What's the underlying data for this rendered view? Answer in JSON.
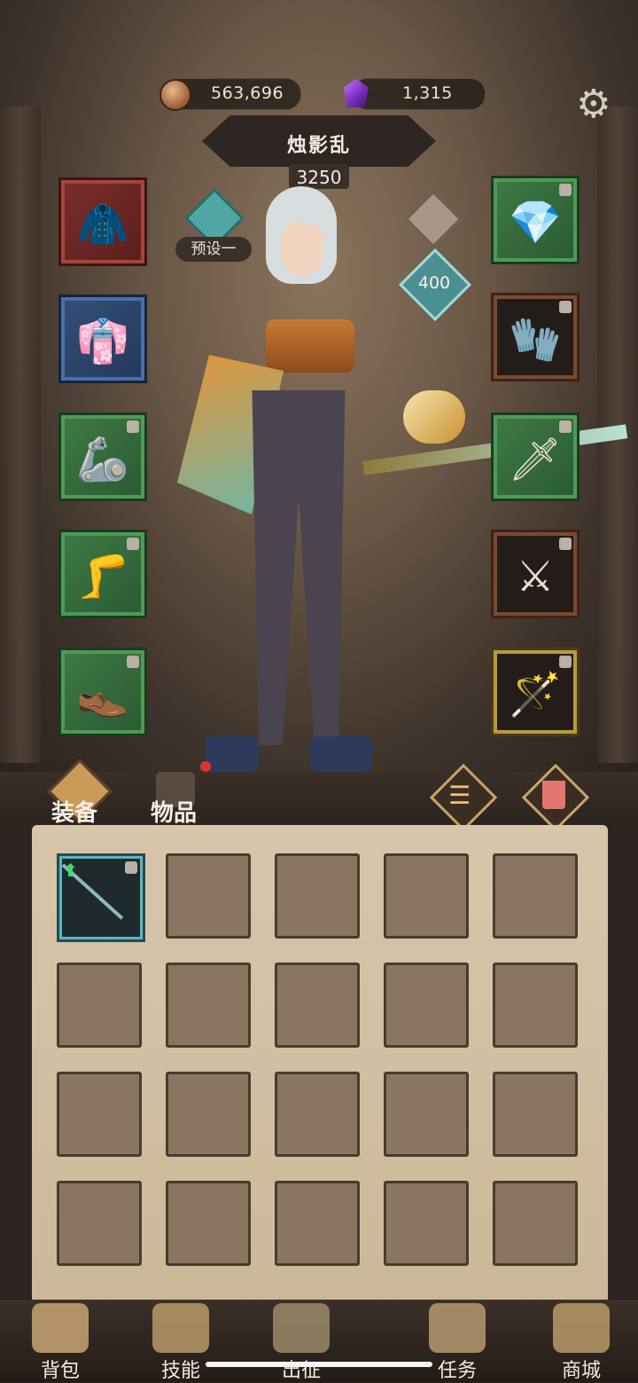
{
  "header": {
    "coins": "563,696",
    "gems": "1,315",
    "settings_icon": "gear-icon"
  },
  "hero": {
    "name": "烛影乱",
    "power": "3250",
    "preset_label": "预设一",
    "stat_value": "400"
  },
  "equipment_left": [
    {
      "name": "red-robe-armor",
      "rarity": "red",
      "locked": false
    },
    {
      "name": "blue-white-tunic",
      "rarity": "green",
      "locked": false
    },
    {
      "name": "wrapped-arm-bandage",
      "rarity": "green",
      "locked": true
    },
    {
      "name": "purple-leg-greaves",
      "rarity": "green",
      "locked": true
    },
    {
      "name": "blue-shoes",
      "rarity": "green",
      "locked": true
    }
  ],
  "equipment_right": [
    {
      "name": "sapphire-pendant",
      "rarity": "green",
      "locked": true
    },
    {
      "name": "purple-gauntlet",
      "rarity": "dark",
      "locked": true
    },
    {
      "name": "blue-dragon-blade",
      "rarity": "green",
      "locked": true
    },
    {
      "name": "thin-blue-sword",
      "rarity": "dark",
      "locked": true
    },
    {
      "name": "lion-head-scepter",
      "rarity": "darkgold",
      "locked": true
    }
  ],
  "inventory": {
    "tabs": [
      "装备",
      "物品"
    ],
    "active_tab": "装备",
    "filter_icon": "list-filter-icon",
    "delete_icon": "trash-icon",
    "rows": 4,
    "cols": 5,
    "first_item": {
      "name": "teal-spear",
      "upgrade_available": true,
      "locked": true
    }
  },
  "nav": {
    "items": [
      {
        "label": "背包",
        "icon": "backpack-icon"
      },
      {
        "label": "技能",
        "icon": "skill-book-icon"
      },
      {
        "label": "出征",
        "icon": "sword-banner-icon"
      },
      {
        "label": "任务",
        "icon": "scroll-quest-icon"
      },
      {
        "label": "商城",
        "icon": "shop-crown-icon"
      }
    ]
  },
  "colors": {
    "accent_gold": "#c99a58",
    "rarity_green": "#4e9a56",
    "rarity_red": "#a5443d",
    "rarity_teal": "#58b8c0",
    "parchment": "#d7c6aa"
  }
}
